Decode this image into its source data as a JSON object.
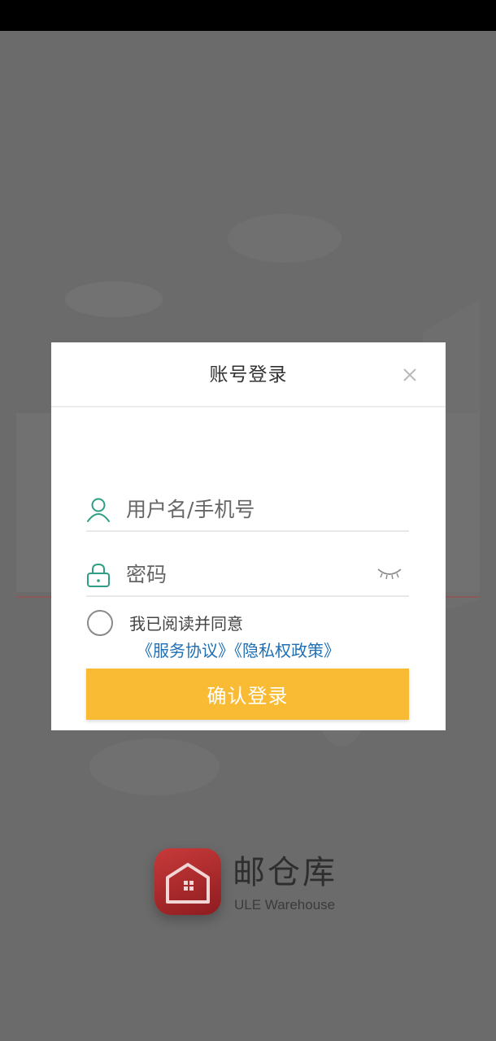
{
  "dialog": {
    "title": "账号登录",
    "username_placeholder": "用户名/手机号",
    "password_placeholder": "密码",
    "agree_text": "我已阅读并同意",
    "service_agreement": "《服务协议》",
    "privacy_policy": "《隐私权政策》",
    "login_label": "确认登录"
  },
  "brand": {
    "name": "邮仓库",
    "subtitle": "ULE Warehouse"
  },
  "icons": {
    "close": "close-icon",
    "user": "user-icon",
    "lock": "lock-icon",
    "eye": "eye-closed-icon",
    "logo": "warehouse-logo-icon"
  },
  "colors": {
    "accent": "#f9bb34",
    "field_icon": "#2f9e84",
    "link": "#1e6fb5",
    "overlay": "#6b6b6b",
    "logo": "#c83a3a"
  }
}
